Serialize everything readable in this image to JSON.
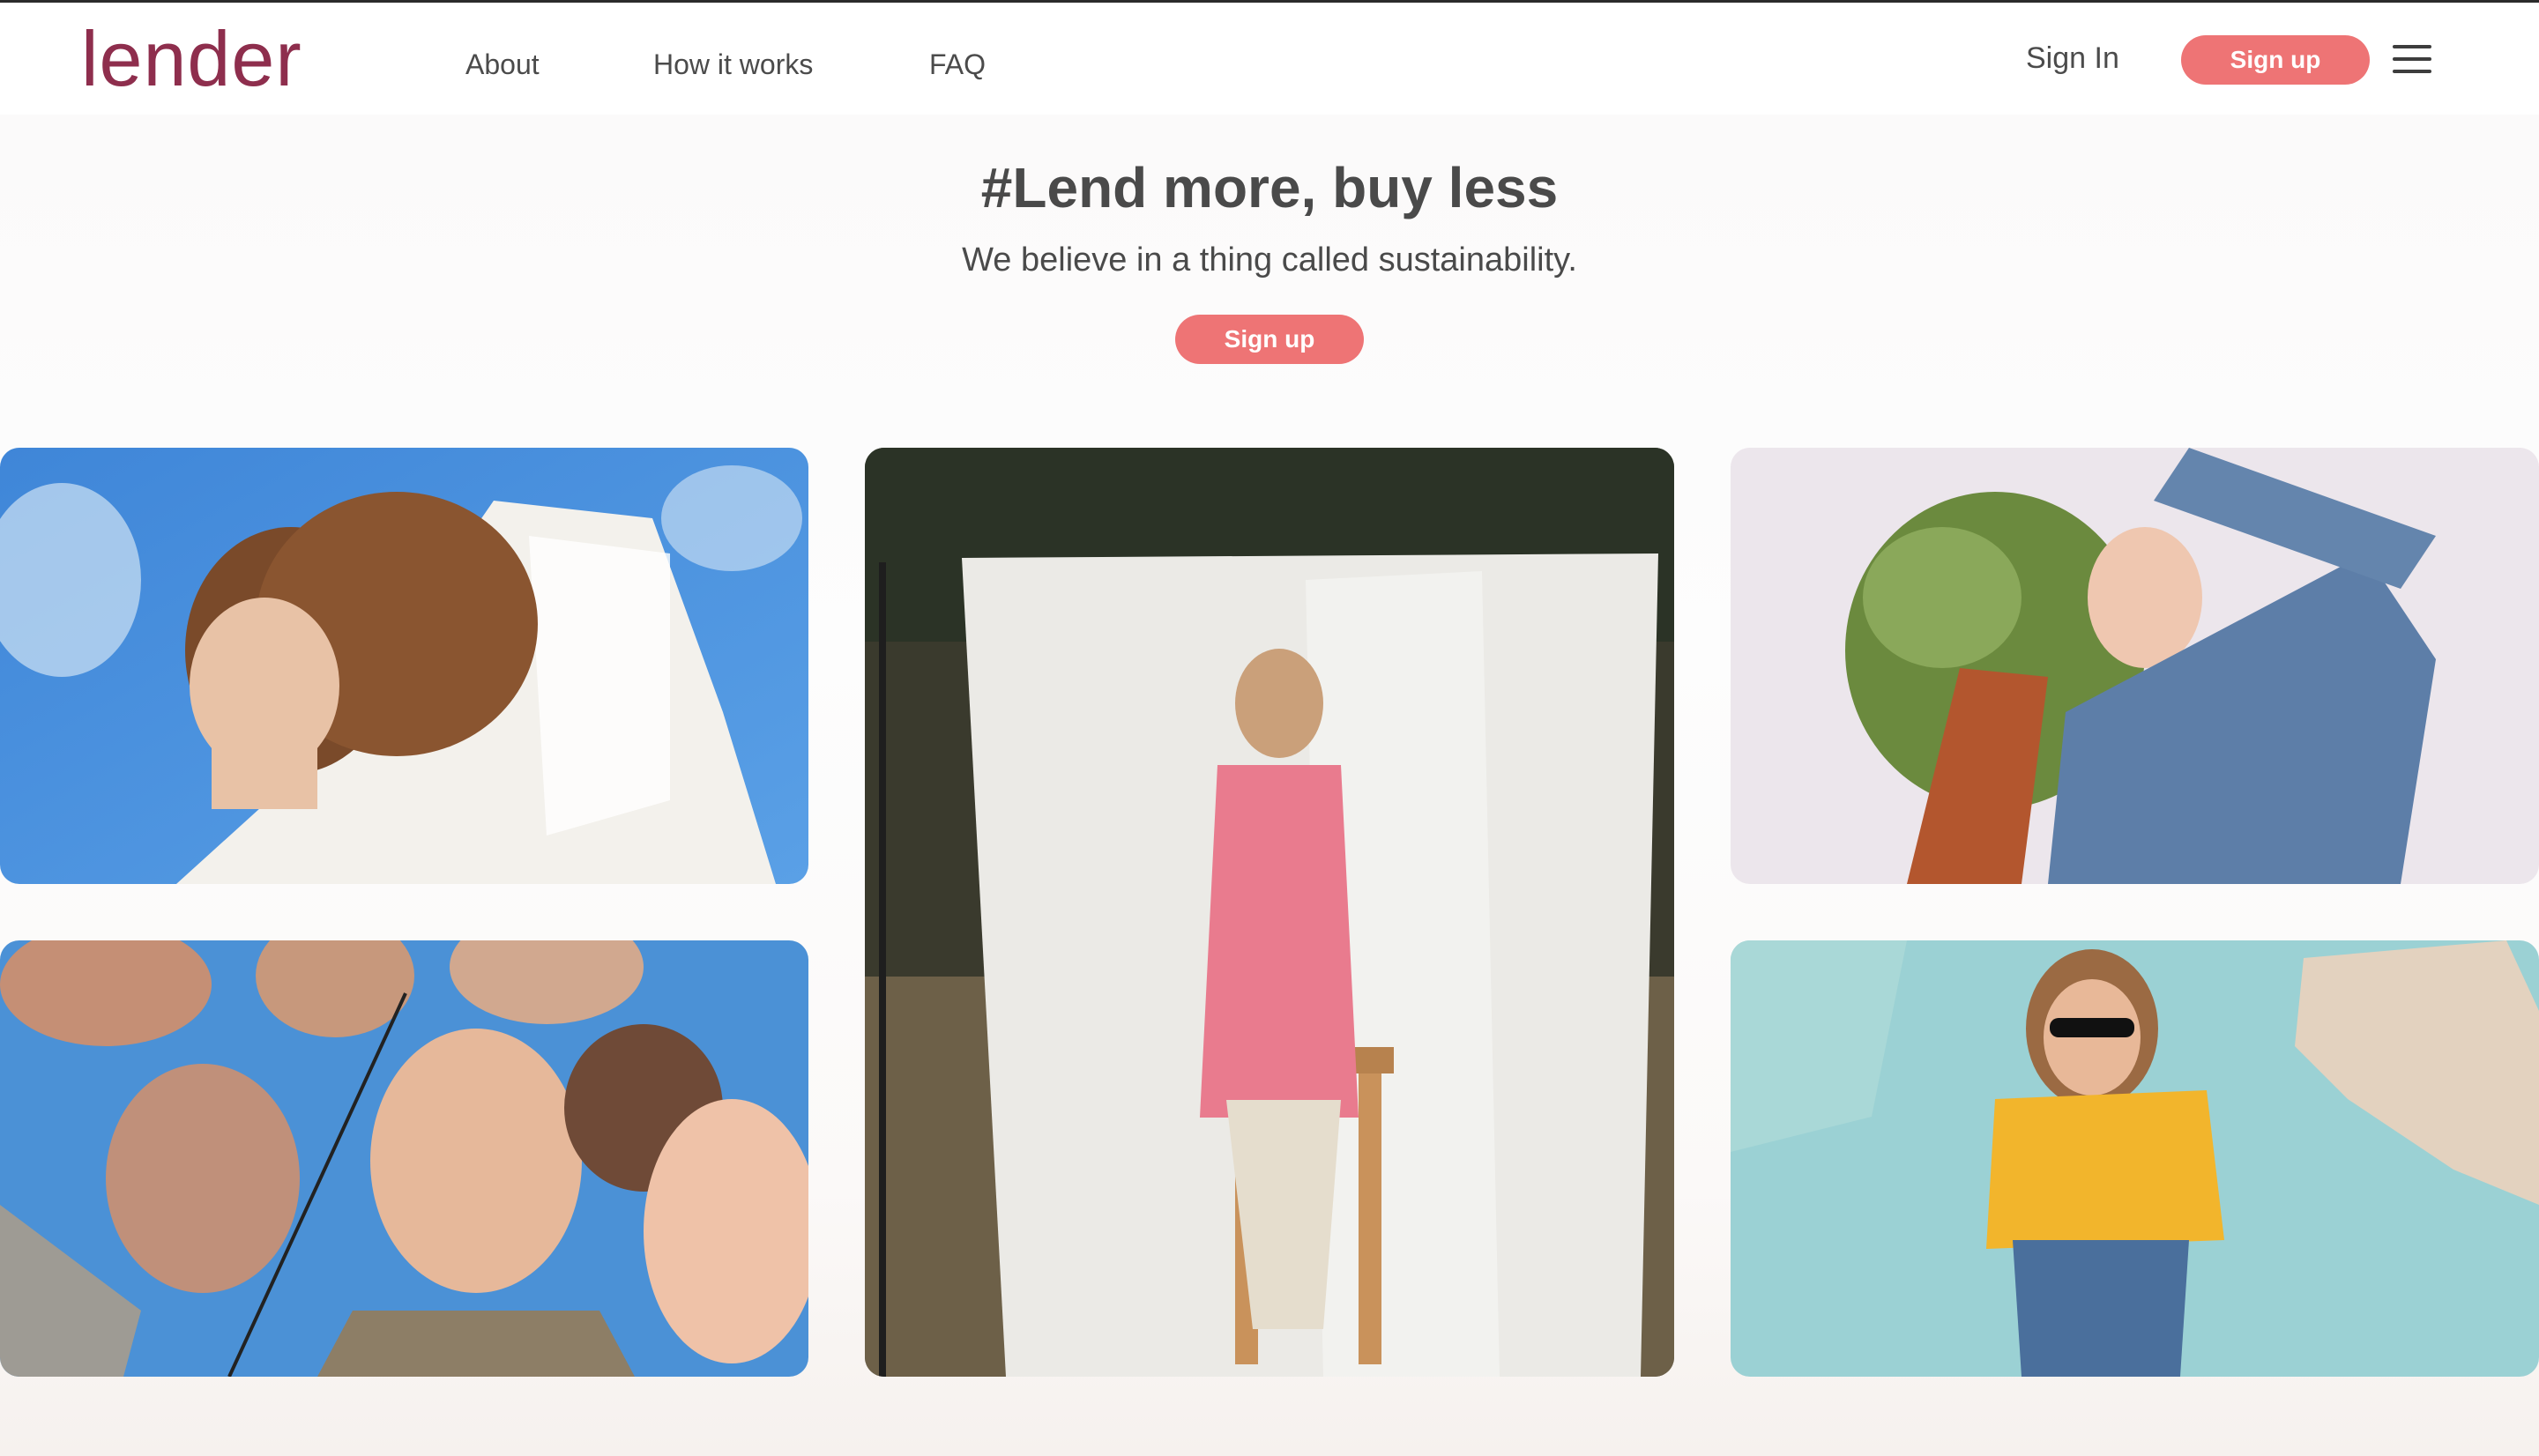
{
  "brand": {
    "logo_text": "lender",
    "accent_color": "#ee7475",
    "logo_color": "#8e2e4d"
  },
  "nav": {
    "links": [
      "About",
      "How it works",
      "FAQ"
    ],
    "sign_in": "Sign In",
    "sign_up": "Sign up",
    "menu_icon": "hamburger-menu-icon"
  },
  "hero": {
    "title": "#Lend more, buy less",
    "subtitle": "We believe in a thing called sustainability.",
    "cta": "Sign up"
  },
  "gallery": {
    "photos": [
      {
        "subject": "woman-with-wind-blown-hair-blue-sky"
      },
      {
        "subject": "woman-in-pink-jacket-on-stool"
      },
      {
        "subject": "woman-with-flowers-in-hair"
      },
      {
        "subject": "group-of-friends-selfie-from-below"
      },
      {
        "subject": "woman-in-yellow-shirt-sunglasses"
      }
    ]
  }
}
